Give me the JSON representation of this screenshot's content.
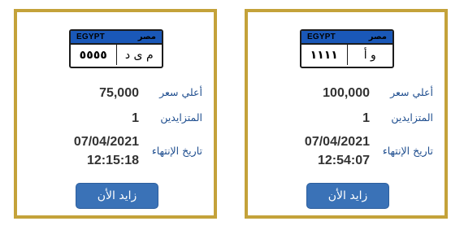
{
  "cards": [
    {
      "plate": {
        "country_en": "EGYPT",
        "country_ar": "مصر",
        "numbers": "١١١١",
        "letters": "و أ"
      },
      "highest_price_label": "أعلي سعر",
      "highest_price": "100,000",
      "bidders_label": "المتزايدين",
      "bidders": "1",
      "end_date_label": "تاريخ الإنتهاء",
      "end_date": "07/04/2021",
      "end_time": "12:54:07",
      "bid_button": "زايد الأن"
    },
    {
      "plate": {
        "country_en": "EGYPT",
        "country_ar": "مصر",
        "numbers": "٥٥٥٥",
        "letters": "م ى د"
      },
      "highest_price_label": "أعلي سعر",
      "highest_price": "75,000",
      "bidders_label": "المتزايدين",
      "bidders": "1",
      "end_date_label": "تاريخ الإنتهاء",
      "end_date": "07/04/2021",
      "end_time": "12:15:18",
      "bid_button": "زايد الأن"
    }
  ],
  "colors": {
    "card_border": "#c4a23a",
    "plate_header": "#1a58b8",
    "label_text": "#1f4e8f",
    "button_bg": "#3a72b7"
  }
}
